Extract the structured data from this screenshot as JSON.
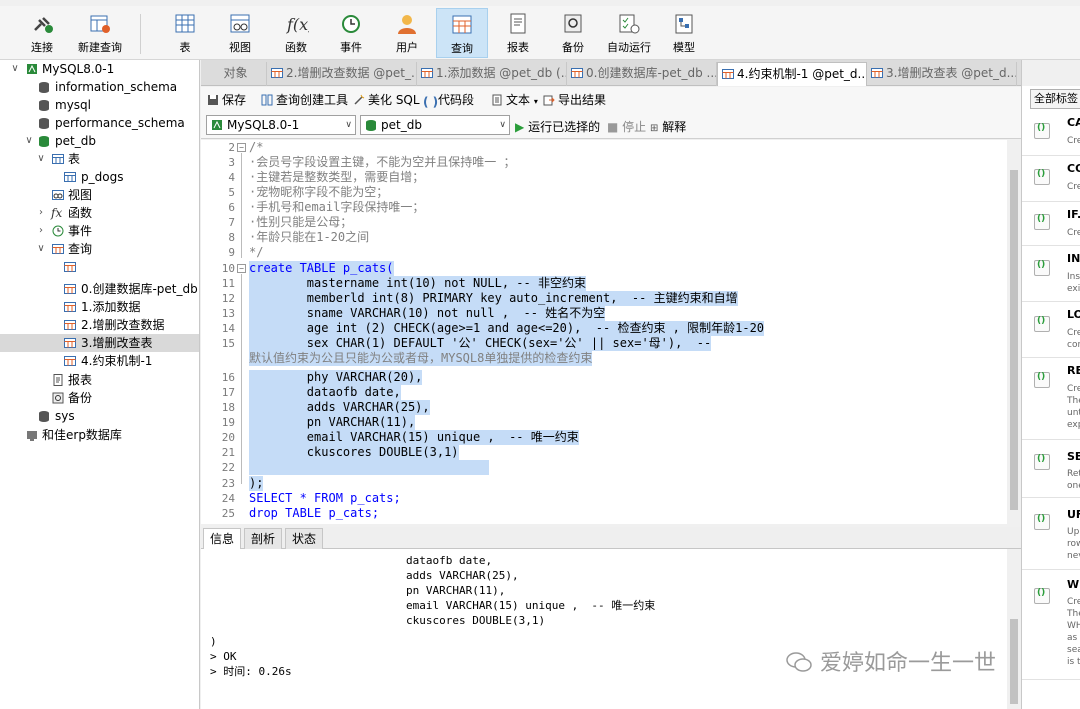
{
  "toolbar": {
    "buttons": [
      {
        "label": "连接",
        "icon": "plug-icon"
      },
      {
        "label": "新建查询",
        "icon": "new-query-icon"
      },
      {
        "label": "表",
        "icon": "table-icon"
      },
      {
        "label": "视图",
        "icon": "view-icon"
      },
      {
        "label": "函数",
        "icon": "function-icon"
      },
      {
        "label": "事件",
        "icon": "event-icon"
      },
      {
        "label": "用户",
        "icon": "user-icon"
      },
      {
        "label": "查询",
        "icon": "query-icon"
      },
      {
        "label": "报表",
        "icon": "report-icon"
      },
      {
        "label": "备份",
        "icon": "backup-icon"
      },
      {
        "label": "自动运行",
        "icon": "autorun-icon"
      },
      {
        "label": "模型",
        "icon": "model-icon"
      }
    ]
  },
  "tree": [
    {
      "label": "MySQL8.0-1",
      "expanded": true
    },
    {
      "label": "information_schema"
    },
    {
      "label": "mysql"
    },
    {
      "label": "performance_schema"
    },
    {
      "label": "pet_db",
      "expanded": true
    },
    {
      "label": "表",
      "expanded": true
    },
    {
      "label": "p_dogs"
    },
    {
      "label": "视图"
    },
    {
      "label": "函数"
    },
    {
      "label": "事件"
    },
    {
      "label": "查询",
      "expanded": true
    },
    {
      "label": ""
    },
    {
      "label": "0.创建数据库-pet_db"
    },
    {
      "label": "1.添加数据"
    },
    {
      "label": "2.增删改查数据"
    },
    {
      "label": "3.增删改查表",
      "selected": true
    },
    {
      "label": "4.约束机制-1"
    },
    {
      "label": "报表"
    },
    {
      "label": "备份"
    },
    {
      "label": "sys"
    },
    {
      "label": "和佳erp数据库"
    }
  ],
  "tabs": [
    {
      "label": "对象"
    },
    {
      "label": "2.增删改查数据 @pet_..."
    },
    {
      "label": "1.添加数据 @pet_db (..."
    },
    {
      "label": "0.创建数据库-pet_db ..."
    },
    {
      "label": "4.约束机制-1 @pet_d...",
      "active": true
    },
    {
      "label": "3.增删改查表 @pet_d..."
    }
  ],
  "editor_toolbar": {
    "save": "保存",
    "query_builder": "查询创建工具",
    "beautify": "美化 SQL",
    "snippet": "代码段",
    "text": "文本",
    "export": "导出结果"
  },
  "connection": {
    "server": "MySQL8.0-1",
    "database": "pet_db",
    "run_selected": "运行已选择的",
    "stop": "停止",
    "explain": "解释"
  },
  "code_lines": [
    {
      "n": "2",
      "t": "/*"
    },
    {
      "n": "3",
      "t": "·会员号字段设置主键，不能为空并且保持唯一 ；"
    },
    {
      "n": "4",
      "t": "·主键若是整数类型，需要自增；"
    },
    {
      "n": "5",
      "t": "·宠物昵称字段不能为空；"
    },
    {
      "n": "6",
      "t": "·手机号和email字段保持唯一；"
    },
    {
      "n": "7",
      "t": "·性别只能是公母；"
    },
    {
      "n": "8",
      "t": "·年龄只能在1-20之间"
    },
    {
      "n": "9",
      "t": "*/"
    },
    {
      "n": "10",
      "t": "create TABLE p_cats("
    },
    {
      "n": "11",
      "t": "        mastername int(10) not NULL, -- 非空约束"
    },
    {
      "n": "12",
      "t": "        memberld int(8) PRIMARY key auto_increment,  -- 主键约束和自增"
    },
    {
      "n": "13",
      "t": "        sname VARCHAR(10) not null ,  -- 姓名不为空"
    },
    {
      "n": "14",
      "t": "        age int (2) CHECK(age>=1 and age<=20),  -- 检查约束 , 限制年龄1-20"
    },
    {
      "n": "15",
      "t": "        sex CHAR(1) DEFAULT '公' CHECK(sex='公' || sex='母'),  --"
    },
    {
      "n": "",
      "t": "默认值约束为公且只能为公或者母，MYSQL8单独提供的检查约束"
    },
    {
      "n": "16",
      "t": "        phy VARCHAR(20),"
    },
    {
      "n": "17",
      "t": "        dataofb date,"
    },
    {
      "n": "18",
      "t": "        adds VARCHAR(25),"
    },
    {
      "n": "19",
      "t": "        pn VARCHAR(11),"
    },
    {
      "n": "20",
      "t": "        email VARCHAR(15) unique ,  -- 唯一约束"
    },
    {
      "n": "21",
      "t": "        ckuscores DOUBLE(3,1)"
    },
    {
      "n": "22",
      "t": ""
    },
    {
      "n": "23",
      "t": ");"
    },
    {
      "n": "24",
      "t": "SELECT * FROM p_cats;"
    },
    {
      "n": "25",
      "t": "drop TABLE p_cats;"
    }
  ],
  "bottom_tabs": [
    "信息",
    "剖析",
    "状态"
  ],
  "output_lines": [
    "dataofb date,",
    "adds VARCHAR(25),",
    "pn VARCHAR(11),",
    "email VARCHAR(15) unique ,  -- 唯一约束",
    "ckuscores DOUBLE(3,1)",
    ")",
    "> OK",
    "> 时间: 0.26s"
  ],
  "watermark": "爱婷如命一生一世",
  "right_panel": {
    "filter": "全部标签",
    "snippets": [
      {
        "title": "CA",
        "desc": [
          "Cre"
        ]
      },
      {
        "title": "CO",
        "desc": [
          "Cre"
        ]
      },
      {
        "title": "IF.",
        "desc": [
          "Cre"
        ]
      },
      {
        "title": "IN",
        "desc": [
          "Ins",
          "exis"
        ]
      },
      {
        "title": "LO",
        "desc": [
          "Cre",
          "con"
        ]
      },
      {
        "title": "RE",
        "desc": [
          "Cre",
          "The",
          "unt",
          "exp"
        ]
      },
      {
        "title": "SE",
        "desc": [
          "Ret",
          "one"
        ]
      },
      {
        "title": "UF",
        "desc": [
          "Up",
          "row",
          "nev"
        ]
      },
      {
        "title": "WH",
        "desc": [
          "Cre",
          "The",
          "WH",
          "as",
          "sea",
          "is t"
        ]
      }
    ]
  }
}
